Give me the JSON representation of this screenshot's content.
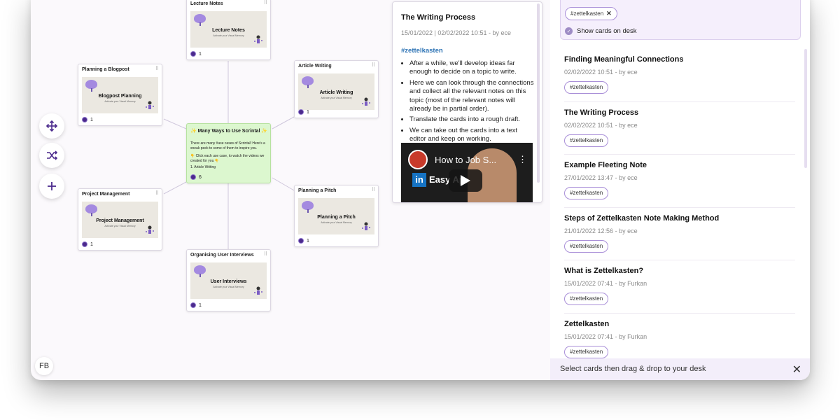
{
  "canvas": {
    "cards": [
      {
        "title": "Lecture Notes",
        "thumb_title": "Lecture Notes",
        "thumb_sub": "Activate your Visual Memory",
        "count": "1"
      },
      {
        "title": "Planning a Blogpost",
        "thumb_title": "Blogpost Planning",
        "thumb_sub": "Activate your Visual Memory",
        "count": "1"
      },
      {
        "title": "Article Writing",
        "thumb_title": "Article Writing",
        "thumb_sub": "Activate your Visual Memory",
        "count": "1"
      },
      {
        "title": "Project Management",
        "thumb_title": "Project Management",
        "thumb_sub": "Activate your Visual Memory",
        "count": "1"
      },
      {
        "title": "Planning a Pitch",
        "thumb_title": "Planning a Pitch",
        "thumb_sub": "Activate your Visual Memory",
        "count": "1"
      },
      {
        "title": "Organising User Interviews",
        "thumb_title": "User Interviews",
        "thumb_sub": "Activate your Visual Memory",
        "count": "1"
      }
    ],
    "center_card": {
      "title": "✨ Many Ways to Use Scrintal ✨",
      "body1": "There are many #use cases of Scrintal! Here's a sneak peek to some of them to inspire you.",
      "body2": "👇 Click each use case, to watch the videos we created for you 👇",
      "body3": "1. Article Writing",
      "count": "6"
    },
    "tools": [
      "move-icon",
      "shuffle-icon",
      "plus-icon"
    ],
    "user_initials": "FB"
  },
  "detail": {
    "title": "The Writing Process",
    "meta": "15/01/2022 | 02/02/2022 10:51 - by ece",
    "tag": "#zettelkasten",
    "bullets": [
      "After a while, we'll develop ideas far enough to decide on a topic to write.",
      "Here we can look through the connections and collect all the relevant notes on this topic (most of the relevant notes will already be in partial order).",
      "Translate the cards into a rough draft.",
      "We can take out the cards into a text editor and keep on working."
    ],
    "video": {
      "title": "How to Job S...",
      "brand": "Easy Ap"
    }
  },
  "sidebar": {
    "filter": {
      "tag": "#zettelkasten",
      "show_label": "Show cards on desk"
    },
    "notes": [
      {
        "title": "Finding Meaningful Connections",
        "meta": "02/02/2022 10:51 - by ece",
        "tag": "#zettelkasten"
      },
      {
        "title": "The Writing Process",
        "meta": "02/02/2022 10:51 - by ece",
        "tag": "#zettelkasten"
      },
      {
        "title": "Example Fleeting Note",
        "meta": "27/01/2022 13:47 - by ece",
        "tag": "#zettelkasten"
      },
      {
        "title": "Steps of Zettelkasten Note Making Method",
        "meta": "21/01/2022 12:56 - by ece",
        "tag": "#zettelkasten"
      },
      {
        "title": "What is Zettelkasten?",
        "meta": "15/01/2022 07:41 - by Furkan",
        "tag": "#zettelkasten"
      },
      {
        "title": "Zettelkasten",
        "meta": "15/01/2022 07:41 - by Furkan",
        "tag": "#zettelkasten"
      }
    ],
    "footer_text": "Select cards then drag & drop to your desk"
  }
}
